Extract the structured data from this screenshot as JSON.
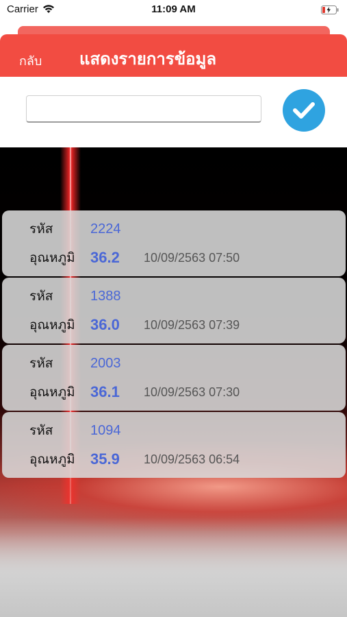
{
  "status_bar": {
    "carrier": "Carrier",
    "time": "11:09 AM",
    "wifi_icon": "wifi-icon",
    "battery_icon": "battery-charging-icon"
  },
  "header": {
    "back_label": "กลับ",
    "title": "แสดงรายการข้อมูล",
    "accent_color": "#f24c42"
  },
  "search": {
    "value": "",
    "placeholder": "",
    "confirm_icon": "check-icon",
    "confirm_color": "#2fa3e0"
  },
  "records": [
    {
      "code_label": "รหัส",
      "code": "2224",
      "temp_label": "อุณหภูมิ",
      "temperature": "36.2",
      "datetime": "10/09/2563 07:50"
    },
    {
      "code_label": "รหัส",
      "code": "1388",
      "temp_label": "อุณหภูมิ",
      "temperature": "36.0",
      "datetime": "10/09/2563 07:39"
    },
    {
      "code_label": "รหัส",
      "code": "2003",
      "temp_label": "อุณหภูมิ",
      "temperature": "36.1",
      "datetime": "10/09/2563 07:30"
    },
    {
      "code_label": "รหัส",
      "code": "1094",
      "temp_label": "อุณหภูมิ",
      "temperature": "35.9",
      "datetime": "10/09/2563 06:54"
    }
  ]
}
